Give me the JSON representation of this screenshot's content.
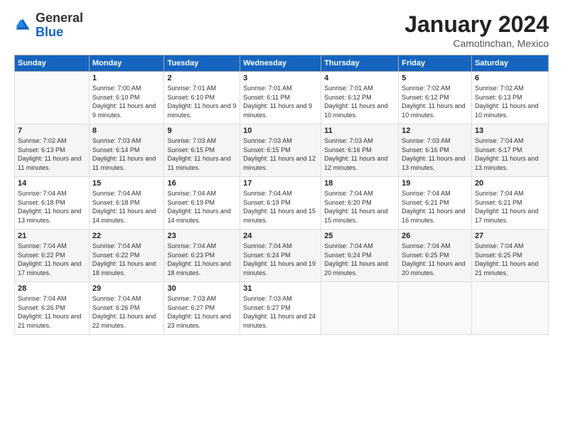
{
  "header": {
    "logo_general": "General",
    "logo_blue": "Blue",
    "title": "January 2024",
    "location": "Camotinchan, Mexico"
  },
  "weekdays": [
    "Sunday",
    "Monday",
    "Tuesday",
    "Wednesday",
    "Thursday",
    "Friday",
    "Saturday"
  ],
  "weeks": [
    [
      {
        "num": "",
        "sunrise": "",
        "sunset": "",
        "daylight": ""
      },
      {
        "num": "1",
        "sunrise": "Sunrise: 7:00 AM",
        "sunset": "Sunset: 6:10 PM",
        "daylight": "Daylight: 11 hours and 9 minutes."
      },
      {
        "num": "2",
        "sunrise": "Sunrise: 7:01 AM",
        "sunset": "Sunset: 6:10 PM",
        "daylight": "Daylight: 11 hours and 9 minutes."
      },
      {
        "num": "3",
        "sunrise": "Sunrise: 7:01 AM",
        "sunset": "Sunset: 6:11 PM",
        "daylight": "Daylight: 11 hours and 9 minutes."
      },
      {
        "num": "4",
        "sunrise": "Sunrise: 7:01 AM",
        "sunset": "Sunset: 6:12 PM",
        "daylight": "Daylight: 11 hours and 10 minutes."
      },
      {
        "num": "5",
        "sunrise": "Sunrise: 7:02 AM",
        "sunset": "Sunset: 6:12 PM",
        "daylight": "Daylight: 11 hours and 10 minutes."
      },
      {
        "num": "6",
        "sunrise": "Sunrise: 7:02 AM",
        "sunset": "Sunset: 6:13 PM",
        "daylight": "Daylight: 11 hours and 10 minutes."
      }
    ],
    [
      {
        "num": "7",
        "sunrise": "Sunrise: 7:02 AM",
        "sunset": "Sunset: 6:13 PM",
        "daylight": "Daylight: 11 hours and 11 minutes."
      },
      {
        "num": "8",
        "sunrise": "Sunrise: 7:03 AM",
        "sunset": "Sunset: 6:14 PM",
        "daylight": "Daylight: 11 hours and 11 minutes."
      },
      {
        "num": "9",
        "sunrise": "Sunrise: 7:03 AM",
        "sunset": "Sunset: 6:15 PM",
        "daylight": "Daylight: 11 hours and 11 minutes."
      },
      {
        "num": "10",
        "sunrise": "Sunrise: 7:03 AM",
        "sunset": "Sunset: 6:15 PM",
        "daylight": "Daylight: 11 hours and 12 minutes."
      },
      {
        "num": "11",
        "sunrise": "Sunrise: 7:03 AM",
        "sunset": "Sunset: 6:16 PM",
        "daylight": "Daylight: 11 hours and 12 minutes."
      },
      {
        "num": "12",
        "sunrise": "Sunrise: 7:03 AM",
        "sunset": "Sunset: 6:16 PM",
        "daylight": "Daylight: 11 hours and 13 minutes."
      },
      {
        "num": "13",
        "sunrise": "Sunrise: 7:04 AM",
        "sunset": "Sunset: 6:17 PM",
        "daylight": "Daylight: 11 hours and 13 minutes."
      }
    ],
    [
      {
        "num": "14",
        "sunrise": "Sunrise: 7:04 AM",
        "sunset": "Sunset: 6:18 PM",
        "daylight": "Daylight: 11 hours and 13 minutes."
      },
      {
        "num": "15",
        "sunrise": "Sunrise: 7:04 AM",
        "sunset": "Sunset: 6:18 PM",
        "daylight": "Daylight: 11 hours and 14 minutes."
      },
      {
        "num": "16",
        "sunrise": "Sunrise: 7:04 AM",
        "sunset": "Sunset: 6:19 PM",
        "daylight": "Daylight: 11 hours and 14 minutes."
      },
      {
        "num": "17",
        "sunrise": "Sunrise: 7:04 AM",
        "sunset": "Sunset: 6:19 PM",
        "daylight": "Daylight: 11 hours and 15 minutes."
      },
      {
        "num": "18",
        "sunrise": "Sunrise: 7:04 AM",
        "sunset": "Sunset: 6:20 PM",
        "daylight": "Daylight: 11 hours and 15 minutes."
      },
      {
        "num": "19",
        "sunrise": "Sunrise: 7:04 AM",
        "sunset": "Sunset: 6:21 PM",
        "daylight": "Daylight: 11 hours and 16 minutes."
      },
      {
        "num": "20",
        "sunrise": "Sunrise: 7:04 AM",
        "sunset": "Sunset: 6:21 PM",
        "daylight": "Daylight: 11 hours and 17 minutes."
      }
    ],
    [
      {
        "num": "21",
        "sunrise": "Sunrise: 7:04 AM",
        "sunset": "Sunset: 6:22 PM",
        "daylight": "Daylight: 11 hours and 17 minutes."
      },
      {
        "num": "22",
        "sunrise": "Sunrise: 7:04 AM",
        "sunset": "Sunset: 6:22 PM",
        "daylight": "Daylight: 11 hours and 18 minutes."
      },
      {
        "num": "23",
        "sunrise": "Sunrise: 7:04 AM",
        "sunset": "Sunset: 6:23 PM",
        "daylight": "Daylight: 11 hours and 18 minutes."
      },
      {
        "num": "24",
        "sunrise": "Sunrise: 7:04 AM",
        "sunset": "Sunset: 6:24 PM",
        "daylight": "Daylight: 11 hours and 19 minutes."
      },
      {
        "num": "25",
        "sunrise": "Sunrise: 7:04 AM",
        "sunset": "Sunset: 6:24 PM",
        "daylight": "Daylight: 11 hours and 20 minutes."
      },
      {
        "num": "26",
        "sunrise": "Sunrise: 7:04 AM",
        "sunset": "Sunset: 6:25 PM",
        "daylight": "Daylight: 11 hours and 20 minutes."
      },
      {
        "num": "27",
        "sunrise": "Sunrise: 7:04 AM",
        "sunset": "Sunset: 6:25 PM",
        "daylight": "Daylight: 11 hours and 21 minutes."
      }
    ],
    [
      {
        "num": "28",
        "sunrise": "Sunrise: 7:04 AM",
        "sunset": "Sunset: 6:26 PM",
        "daylight": "Daylight: 11 hours and 21 minutes."
      },
      {
        "num": "29",
        "sunrise": "Sunrise: 7:04 AM",
        "sunset": "Sunset: 6:26 PM",
        "daylight": "Daylight: 11 hours and 22 minutes."
      },
      {
        "num": "30",
        "sunrise": "Sunrise: 7:03 AM",
        "sunset": "Sunset: 6:27 PM",
        "daylight": "Daylight: 11 hours and 23 minutes."
      },
      {
        "num": "31",
        "sunrise": "Sunrise: 7:03 AM",
        "sunset": "Sunset: 6:27 PM",
        "daylight": "Daylight: 11 hours and 24 minutes."
      },
      {
        "num": "",
        "sunrise": "",
        "sunset": "",
        "daylight": ""
      },
      {
        "num": "",
        "sunrise": "",
        "sunset": "",
        "daylight": ""
      },
      {
        "num": "",
        "sunrise": "",
        "sunset": "",
        "daylight": ""
      }
    ]
  ]
}
